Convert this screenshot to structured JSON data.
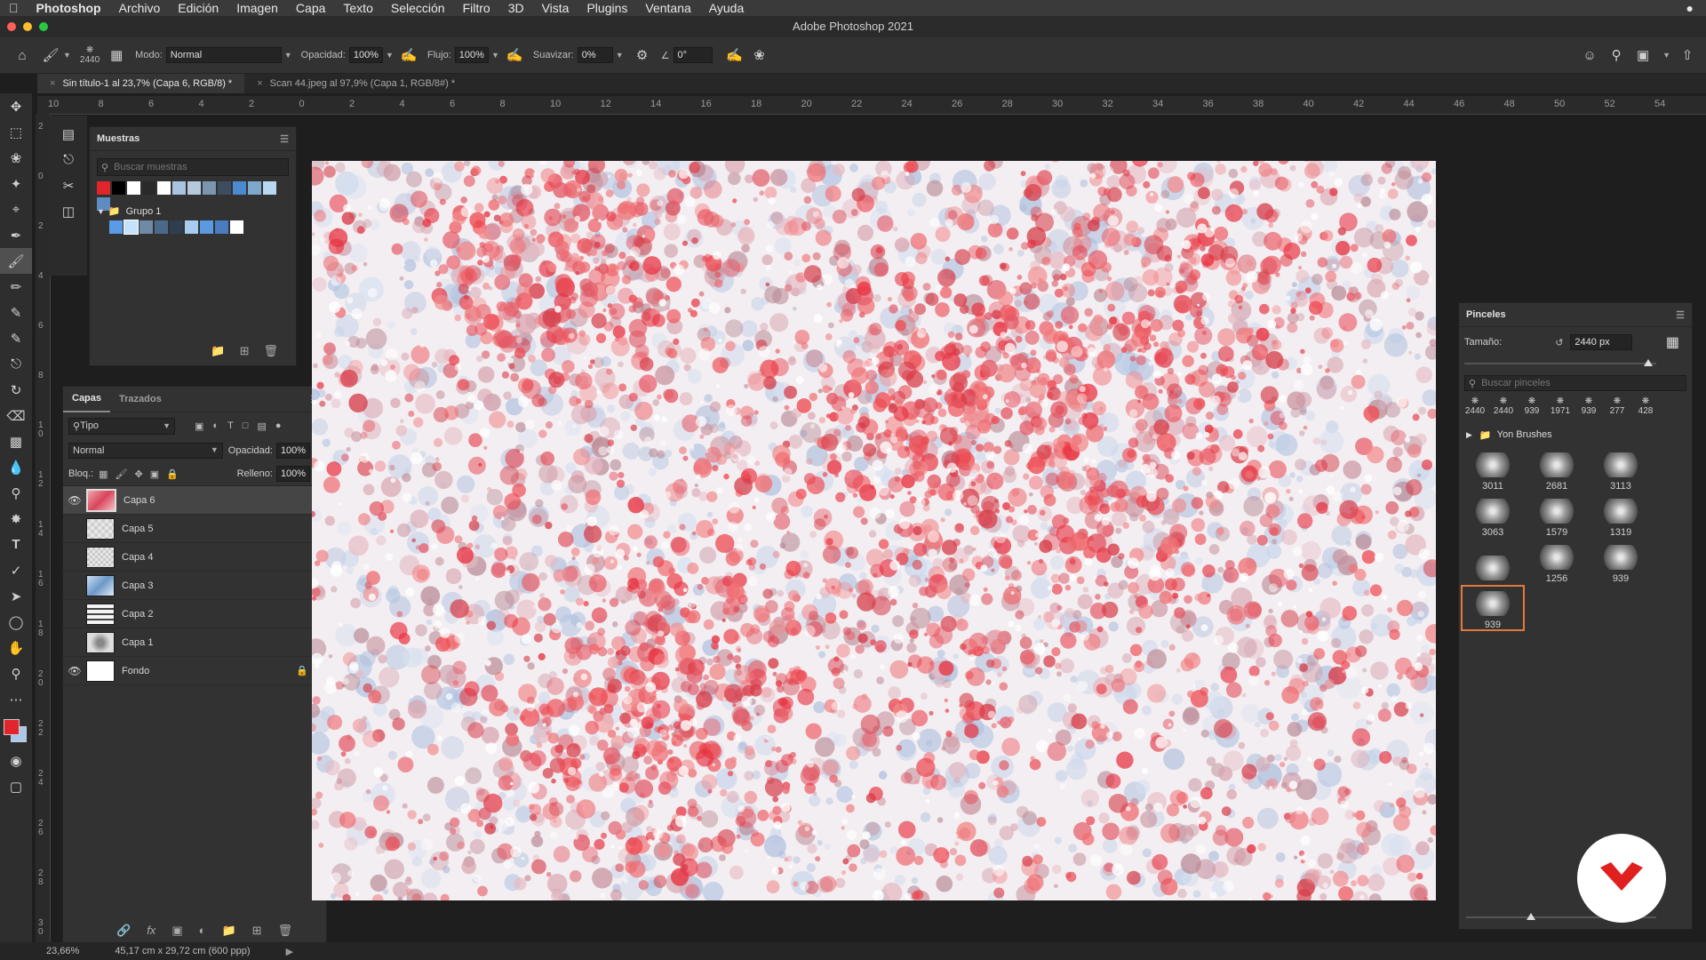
{
  "menubar": {
    "app": "Photoshop",
    "items": [
      "Archivo",
      "Edición",
      "Imagen",
      "Capa",
      "Texto",
      "Selección",
      "Filtro",
      "3D",
      "Vista",
      "Plugins",
      "Ventana",
      "Ayuda"
    ]
  },
  "window": {
    "title": "Adobe Photoshop 2021"
  },
  "options": {
    "brush_size": "2440",
    "mode_label": "Modo:",
    "mode_value": "Normal",
    "opacity_label": "Opacidad:",
    "opacity_value": "100%",
    "flow_label": "Flujo:",
    "flow_value": "100%",
    "smooth_label": "Suavizar:",
    "smooth_value": "0%",
    "angle_value": "0°"
  },
  "tabs": [
    {
      "label": "Sin título-1 al 23,7% (Capa 6, RGB/8) *"
    },
    {
      "label": "Scan 44.jpeg al 97,9% (Capa 1, RGB/8#) *"
    }
  ],
  "ruler_h": [
    "10",
    "8",
    "6",
    "4",
    "2",
    "0",
    "2",
    "4",
    "6",
    "8",
    "10",
    "12",
    "14",
    "16",
    "18",
    "20",
    "22",
    "24",
    "26",
    "28",
    "30",
    "32",
    "34",
    "36",
    "38",
    "40",
    "42",
    "44",
    "46",
    "48",
    "50",
    "52",
    "54"
  ],
  "ruler_v": [
    "2",
    "0",
    "2",
    "4",
    "6",
    "8",
    "1\n0",
    "1\n2",
    "1\n4",
    "1\n6",
    "1\n8",
    "2\n0",
    "2\n2",
    "2\n4",
    "2\n6",
    "2\n8",
    "3\n0"
  ],
  "swatches": {
    "title": "Muestras",
    "search_placeholder": "Buscar muestras",
    "group_name": "Grupo 1",
    "colors_top": [
      "#e2242c",
      "#000000",
      "#ffffff",
      "#2a2a2a",
      "#ffffff",
      "#a8c4e2",
      "#b6c9dc",
      "#7c94ac",
      "#3c4d60",
      "#4a8ad0",
      "#7ea8cc",
      "#b8d8f2",
      "#5c8cc0"
    ],
    "colors_group": [
      "#5a9ae6",
      "#c6e2fa",
      "#6f8aa6",
      "#4a6a8a",
      "#2e3e50",
      "#a6ccf0",
      "#5c9ae0",
      "#4a7cc0",
      "#ffffff"
    ]
  },
  "layers": {
    "tab_layers": "Capas",
    "tab_paths": "Trazados",
    "filter_kind": "Tipo",
    "blend_mode": "Normal",
    "opacity_label": "Opacidad:",
    "opacity_value": "100%",
    "lock_label": "Bloq.:",
    "fill_label": "Relleno:",
    "fill_value": "100%",
    "rows": [
      {
        "name": "Capa 6",
        "visible": true
      },
      {
        "name": "Capa 5",
        "visible": false
      },
      {
        "name": "Capa 4",
        "visible": false
      },
      {
        "name": "Capa 3",
        "visible": false
      },
      {
        "name": "Capa 2",
        "visible": false
      },
      {
        "name": "Capa 1",
        "visible": false
      },
      {
        "name": "Fondo",
        "visible": true
      }
    ]
  },
  "brushes": {
    "title": "Pinceles",
    "size_label": "Tamaño:",
    "size_value": "2440 px",
    "search_placeholder": "Buscar pinceles",
    "recent": [
      "2440",
      "2440",
      "939",
      "1971",
      "939",
      "277",
      "428"
    ],
    "folder": "Yon Brushes",
    "grid": [
      "3011",
      "2681",
      "3113",
      "3063",
      "1579",
      "1319",
      "",
      "1256",
      "939",
      "939"
    ]
  },
  "status": {
    "zoom": "23,66%",
    "doc_size": "45,17 cm x 29,72 cm (600 ppp)"
  },
  "colors": {
    "foreground": "#e2242c",
    "background": "#a8c8ec",
    "accent_selection": "#e07a3c",
    "logo": "#e0201e"
  }
}
